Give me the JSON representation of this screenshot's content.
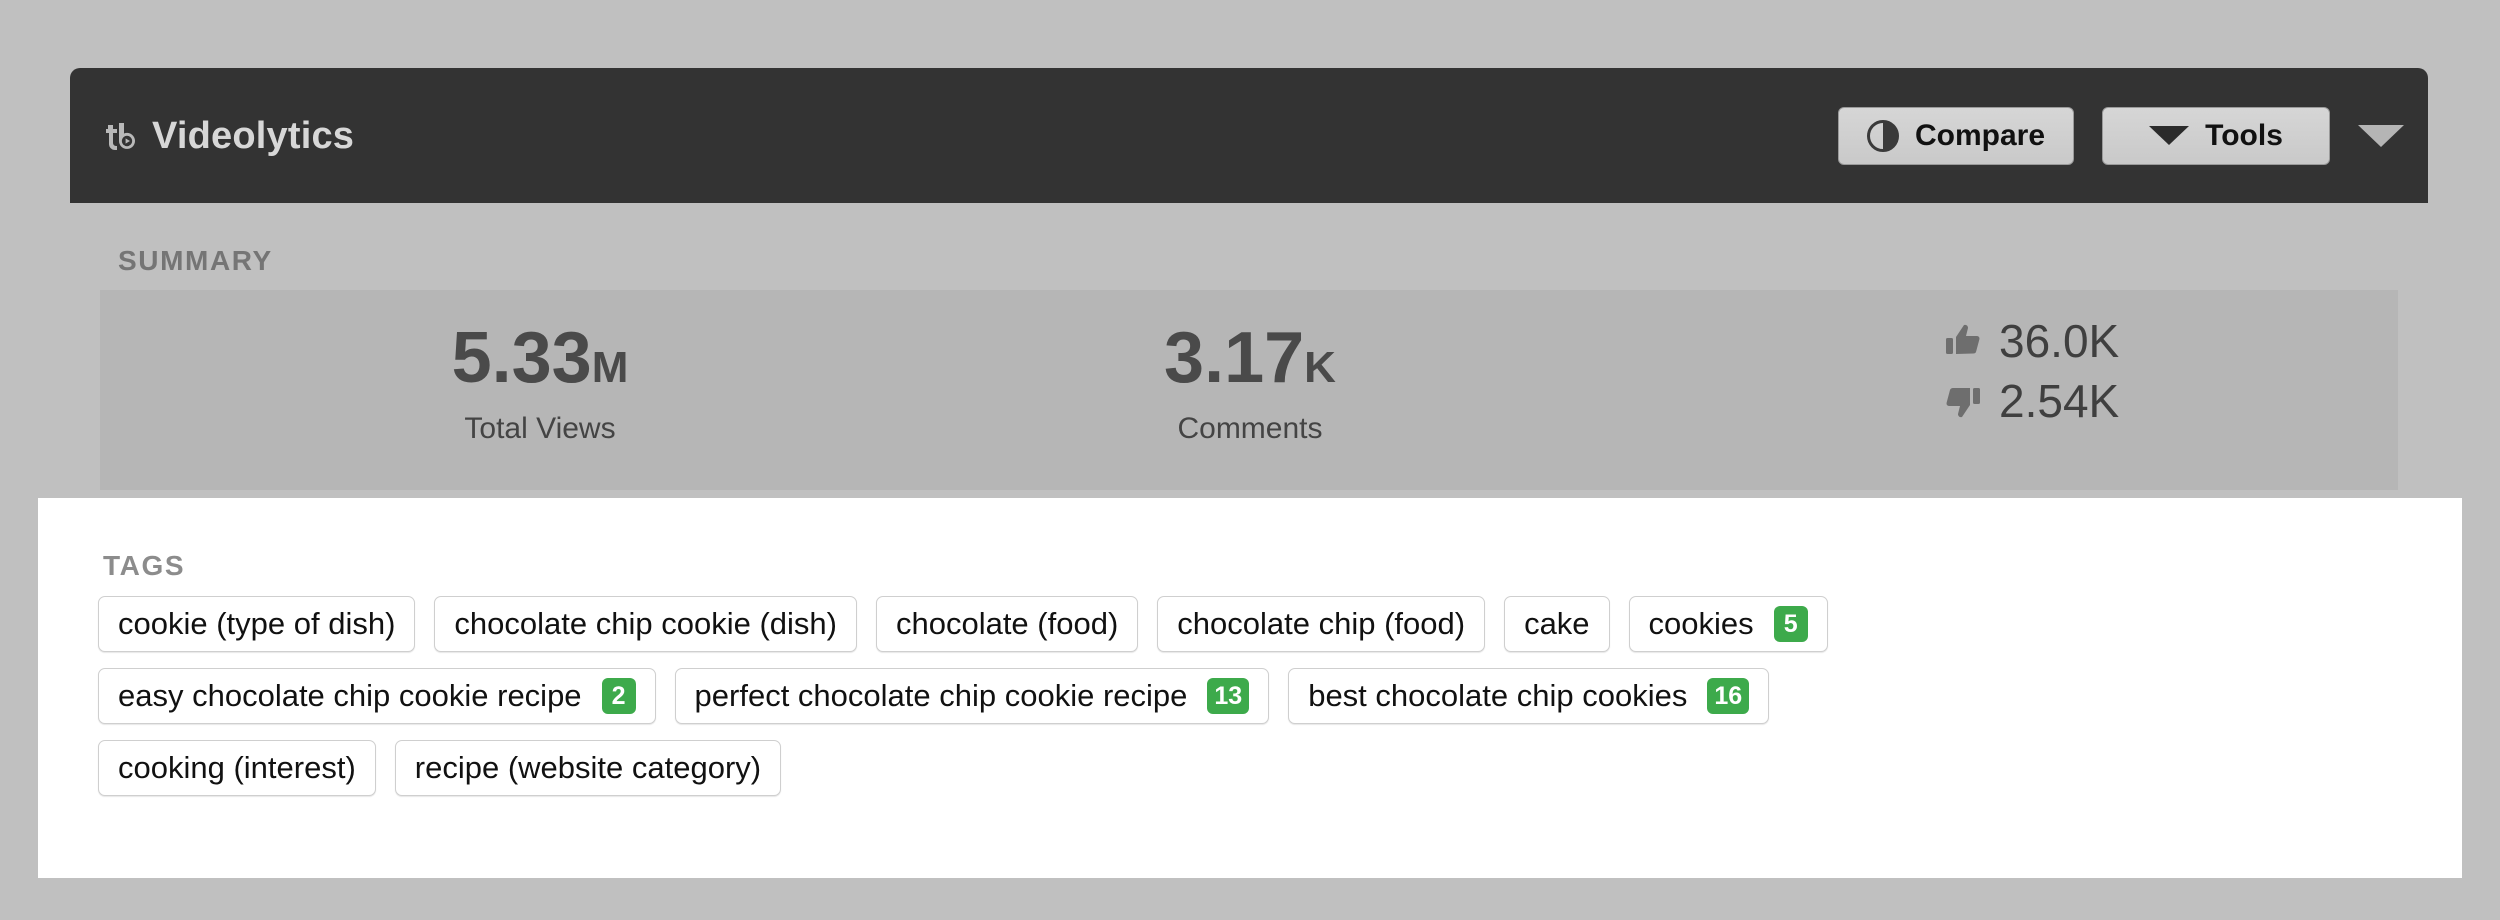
{
  "header": {
    "logo_icon": "tubebuddy-tb-logo",
    "title": "Videolytics",
    "compare_label": "Compare",
    "compare_icon": "contrast-circle-icon",
    "tools_label": "Tools",
    "tools_icon": "caret-down-icon",
    "collapse_icon": "caret-down-icon",
    "background_color": "#333333"
  },
  "summary": {
    "section_label": "SUMMARY",
    "stats": [
      {
        "value": "5.33",
        "unit": "M",
        "label": "Total Views"
      },
      {
        "value": "3.17",
        "unit": "K",
        "label": "Comments"
      }
    ],
    "ratings": [
      {
        "icon": "thumbs-up-icon",
        "value": "36.0K"
      },
      {
        "icon": "thumbs-down-icon",
        "value": "2.54K"
      }
    ]
  },
  "tags": {
    "section_label": "TAGS",
    "badge_color": "#3daa4b",
    "rows": [
      [
        {
          "label": "cookie (type of dish)",
          "badge": null
        },
        {
          "label": "chocolate chip cookie (dish)",
          "badge": null
        },
        {
          "label": "chocolate (food)",
          "badge": null
        },
        {
          "label": "chocolate chip (food)",
          "badge": null
        },
        {
          "label": "cake",
          "badge": null
        },
        {
          "label": "cookies",
          "badge": "5"
        }
      ],
      [
        {
          "label": "easy chocolate chip cookie recipe",
          "badge": "2"
        },
        {
          "label": "perfect chocolate chip cookie recipe",
          "badge": "13"
        },
        {
          "label": "best chocolate chip cookies",
          "badge": "16"
        }
      ],
      [
        {
          "label": "cooking (interest)",
          "badge": null
        },
        {
          "label": "recipe (website category)",
          "badge": null
        }
      ]
    ]
  }
}
